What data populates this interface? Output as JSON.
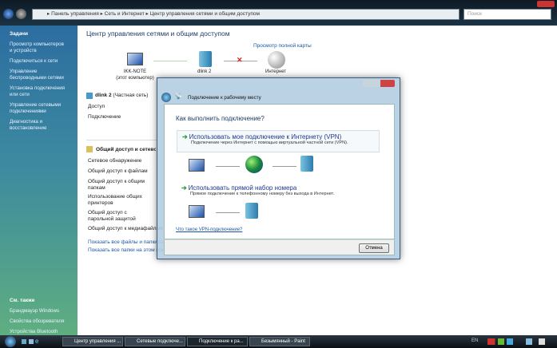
{
  "address": {
    "crumbs": [
      "Панель управления",
      "Сеть и Интернет",
      "Центр управления сетями и общим доступом"
    ],
    "search_placeholder": "Поиск"
  },
  "sidebar": {
    "tasks_heading": "Задачи",
    "tasks": [
      "Просмотр компьютеров и устройств",
      "Подключиться к сети",
      "Управление беспроводными сетями",
      "Установка подключения или сети",
      "Управление сетевыми подключениями",
      "Диагностика и восстановление"
    ],
    "see_also_heading": "См. также",
    "see_also": [
      "Брандмауэр Windows",
      "Свойства обозревателя",
      "Устройства Bluetooth"
    ]
  },
  "main": {
    "title": "Центр управления сетями и общим доступом",
    "full_map_link": "Просмотр полной карты",
    "map": {
      "computer_name": "IKK-NOTE",
      "computer_sub": "(этот компьютер)",
      "network": "dlink 2",
      "internet": "Интернет"
    },
    "network_name": "dlink 2",
    "network_type": "(Частная сеть)",
    "rows": [
      "Доступ",
      "Подключение"
    ],
    "sharing_heading": "Общий доступ и сетевое обнаружение",
    "sharing_rows": [
      "Сетевое обнаружение",
      "Общий доступ к файлам",
      "Общий доступ к общим папкам",
      "Использование общих принтеров",
      "Общий доступ с парольной защитой",
      "Общий доступ к медиафайлам"
    ],
    "links": [
      "Показать все файлы и папки на",
      "Показать все папки на этом ком"
    ]
  },
  "dialog": {
    "title": "Подключение к рабочему месту",
    "question": "Как выполнить подключение?",
    "option1_title": "Использовать мое подключение к Интернету (VPN)",
    "option1_desc": "Подключение через Интернет с помощью виртуальной частной сети (VPN).",
    "option2_title": "Использовать прямой набор номера",
    "option2_desc": "Прямое подключение к телефонному номеру без выхода в Интернет.",
    "help_link": "Что такое VPN-подключение?",
    "cancel": "Отмена"
  },
  "taskbar": {
    "tasks": [
      "Центр управления ...",
      "Сетевые подключе...",
      "Подключение к ра...",
      "Безымянный - Paint"
    ],
    "lang": "EN"
  }
}
